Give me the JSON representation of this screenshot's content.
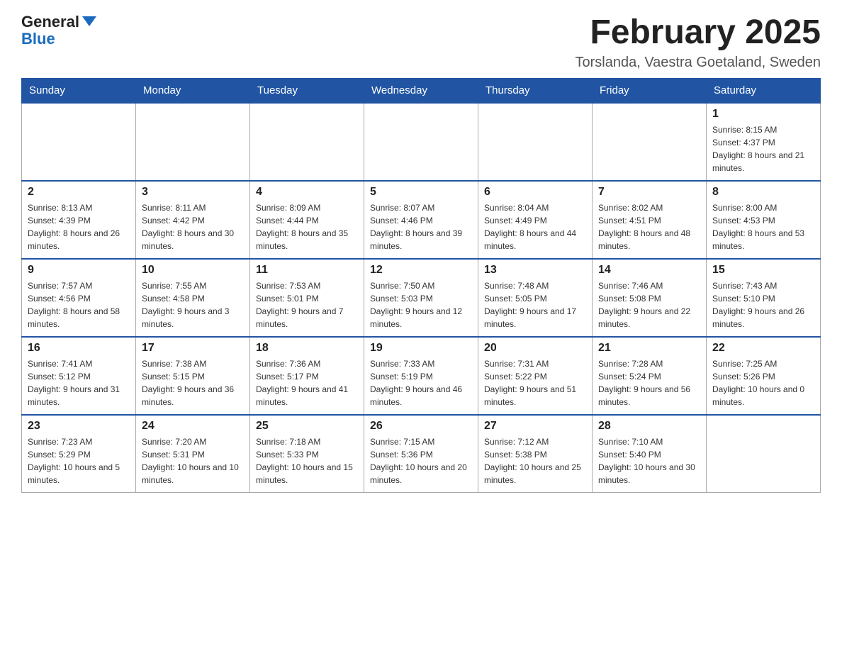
{
  "header": {
    "logo_general": "General",
    "logo_blue": "Blue",
    "month_title": "February 2025",
    "location": "Torslanda, Vaestra Goetaland, Sweden"
  },
  "days_of_week": [
    "Sunday",
    "Monday",
    "Tuesday",
    "Wednesday",
    "Thursday",
    "Friday",
    "Saturday"
  ],
  "weeks": [
    [
      {
        "day": "",
        "sunrise": "",
        "sunset": "",
        "daylight": ""
      },
      {
        "day": "",
        "sunrise": "",
        "sunset": "",
        "daylight": ""
      },
      {
        "day": "",
        "sunrise": "",
        "sunset": "",
        "daylight": ""
      },
      {
        "day": "",
        "sunrise": "",
        "sunset": "",
        "daylight": ""
      },
      {
        "day": "",
        "sunrise": "",
        "sunset": "",
        "daylight": ""
      },
      {
        "day": "",
        "sunrise": "",
        "sunset": "",
        "daylight": ""
      },
      {
        "day": "1",
        "sunrise": "Sunrise: 8:15 AM",
        "sunset": "Sunset: 4:37 PM",
        "daylight": "Daylight: 8 hours and 21 minutes."
      }
    ],
    [
      {
        "day": "2",
        "sunrise": "Sunrise: 8:13 AM",
        "sunset": "Sunset: 4:39 PM",
        "daylight": "Daylight: 8 hours and 26 minutes."
      },
      {
        "day": "3",
        "sunrise": "Sunrise: 8:11 AM",
        "sunset": "Sunset: 4:42 PM",
        "daylight": "Daylight: 8 hours and 30 minutes."
      },
      {
        "day": "4",
        "sunrise": "Sunrise: 8:09 AM",
        "sunset": "Sunset: 4:44 PM",
        "daylight": "Daylight: 8 hours and 35 minutes."
      },
      {
        "day": "5",
        "sunrise": "Sunrise: 8:07 AM",
        "sunset": "Sunset: 4:46 PM",
        "daylight": "Daylight: 8 hours and 39 minutes."
      },
      {
        "day": "6",
        "sunrise": "Sunrise: 8:04 AM",
        "sunset": "Sunset: 4:49 PM",
        "daylight": "Daylight: 8 hours and 44 minutes."
      },
      {
        "day": "7",
        "sunrise": "Sunrise: 8:02 AM",
        "sunset": "Sunset: 4:51 PM",
        "daylight": "Daylight: 8 hours and 48 minutes."
      },
      {
        "day": "8",
        "sunrise": "Sunrise: 8:00 AM",
        "sunset": "Sunset: 4:53 PM",
        "daylight": "Daylight: 8 hours and 53 minutes."
      }
    ],
    [
      {
        "day": "9",
        "sunrise": "Sunrise: 7:57 AM",
        "sunset": "Sunset: 4:56 PM",
        "daylight": "Daylight: 8 hours and 58 minutes."
      },
      {
        "day": "10",
        "sunrise": "Sunrise: 7:55 AM",
        "sunset": "Sunset: 4:58 PM",
        "daylight": "Daylight: 9 hours and 3 minutes."
      },
      {
        "day": "11",
        "sunrise": "Sunrise: 7:53 AM",
        "sunset": "Sunset: 5:01 PM",
        "daylight": "Daylight: 9 hours and 7 minutes."
      },
      {
        "day": "12",
        "sunrise": "Sunrise: 7:50 AM",
        "sunset": "Sunset: 5:03 PM",
        "daylight": "Daylight: 9 hours and 12 minutes."
      },
      {
        "day": "13",
        "sunrise": "Sunrise: 7:48 AM",
        "sunset": "Sunset: 5:05 PM",
        "daylight": "Daylight: 9 hours and 17 minutes."
      },
      {
        "day": "14",
        "sunrise": "Sunrise: 7:46 AM",
        "sunset": "Sunset: 5:08 PM",
        "daylight": "Daylight: 9 hours and 22 minutes."
      },
      {
        "day": "15",
        "sunrise": "Sunrise: 7:43 AM",
        "sunset": "Sunset: 5:10 PM",
        "daylight": "Daylight: 9 hours and 26 minutes."
      }
    ],
    [
      {
        "day": "16",
        "sunrise": "Sunrise: 7:41 AM",
        "sunset": "Sunset: 5:12 PM",
        "daylight": "Daylight: 9 hours and 31 minutes."
      },
      {
        "day": "17",
        "sunrise": "Sunrise: 7:38 AM",
        "sunset": "Sunset: 5:15 PM",
        "daylight": "Daylight: 9 hours and 36 minutes."
      },
      {
        "day": "18",
        "sunrise": "Sunrise: 7:36 AM",
        "sunset": "Sunset: 5:17 PM",
        "daylight": "Daylight: 9 hours and 41 minutes."
      },
      {
        "day": "19",
        "sunrise": "Sunrise: 7:33 AM",
        "sunset": "Sunset: 5:19 PM",
        "daylight": "Daylight: 9 hours and 46 minutes."
      },
      {
        "day": "20",
        "sunrise": "Sunrise: 7:31 AM",
        "sunset": "Sunset: 5:22 PM",
        "daylight": "Daylight: 9 hours and 51 minutes."
      },
      {
        "day": "21",
        "sunrise": "Sunrise: 7:28 AM",
        "sunset": "Sunset: 5:24 PM",
        "daylight": "Daylight: 9 hours and 56 minutes."
      },
      {
        "day": "22",
        "sunrise": "Sunrise: 7:25 AM",
        "sunset": "Sunset: 5:26 PM",
        "daylight": "Daylight: 10 hours and 0 minutes."
      }
    ],
    [
      {
        "day": "23",
        "sunrise": "Sunrise: 7:23 AM",
        "sunset": "Sunset: 5:29 PM",
        "daylight": "Daylight: 10 hours and 5 minutes."
      },
      {
        "day": "24",
        "sunrise": "Sunrise: 7:20 AM",
        "sunset": "Sunset: 5:31 PM",
        "daylight": "Daylight: 10 hours and 10 minutes."
      },
      {
        "day": "25",
        "sunrise": "Sunrise: 7:18 AM",
        "sunset": "Sunset: 5:33 PM",
        "daylight": "Daylight: 10 hours and 15 minutes."
      },
      {
        "day": "26",
        "sunrise": "Sunrise: 7:15 AM",
        "sunset": "Sunset: 5:36 PM",
        "daylight": "Daylight: 10 hours and 20 minutes."
      },
      {
        "day": "27",
        "sunrise": "Sunrise: 7:12 AM",
        "sunset": "Sunset: 5:38 PM",
        "daylight": "Daylight: 10 hours and 25 minutes."
      },
      {
        "day": "28",
        "sunrise": "Sunrise: 7:10 AM",
        "sunset": "Sunset: 5:40 PM",
        "daylight": "Daylight: 10 hours and 30 minutes."
      },
      {
        "day": "",
        "sunrise": "",
        "sunset": "",
        "daylight": ""
      }
    ]
  ]
}
